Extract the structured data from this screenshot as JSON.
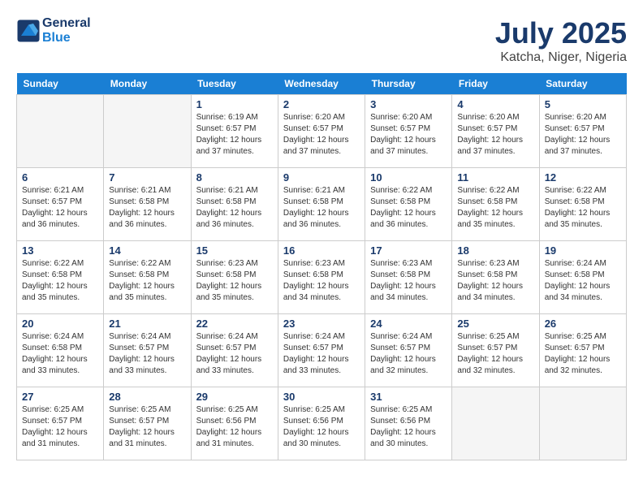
{
  "header": {
    "logo_line1": "General",
    "logo_line2": "Blue",
    "month_title": "July 2025",
    "location": "Katcha, Niger, Nigeria"
  },
  "weekdays": [
    "Sunday",
    "Monday",
    "Tuesday",
    "Wednesday",
    "Thursday",
    "Friday",
    "Saturday"
  ],
  "weeks": [
    [
      {
        "day": "",
        "empty": true
      },
      {
        "day": "",
        "empty": true
      },
      {
        "day": "1",
        "sunrise": "6:19 AM",
        "sunset": "6:57 PM",
        "daylight": "12 hours and 37 minutes."
      },
      {
        "day": "2",
        "sunrise": "6:20 AM",
        "sunset": "6:57 PM",
        "daylight": "12 hours and 37 minutes."
      },
      {
        "day": "3",
        "sunrise": "6:20 AM",
        "sunset": "6:57 PM",
        "daylight": "12 hours and 37 minutes."
      },
      {
        "day": "4",
        "sunrise": "6:20 AM",
        "sunset": "6:57 PM",
        "daylight": "12 hours and 37 minutes."
      },
      {
        "day": "5",
        "sunrise": "6:20 AM",
        "sunset": "6:57 PM",
        "daylight": "12 hours and 37 minutes."
      }
    ],
    [
      {
        "day": "6",
        "sunrise": "6:21 AM",
        "sunset": "6:57 PM",
        "daylight": "12 hours and 36 minutes."
      },
      {
        "day": "7",
        "sunrise": "6:21 AM",
        "sunset": "6:58 PM",
        "daylight": "12 hours and 36 minutes."
      },
      {
        "day": "8",
        "sunrise": "6:21 AM",
        "sunset": "6:58 PM",
        "daylight": "12 hours and 36 minutes."
      },
      {
        "day": "9",
        "sunrise": "6:21 AM",
        "sunset": "6:58 PM",
        "daylight": "12 hours and 36 minutes."
      },
      {
        "day": "10",
        "sunrise": "6:22 AM",
        "sunset": "6:58 PM",
        "daylight": "12 hours and 36 minutes."
      },
      {
        "day": "11",
        "sunrise": "6:22 AM",
        "sunset": "6:58 PM",
        "daylight": "12 hours and 35 minutes."
      },
      {
        "day": "12",
        "sunrise": "6:22 AM",
        "sunset": "6:58 PM",
        "daylight": "12 hours and 35 minutes."
      }
    ],
    [
      {
        "day": "13",
        "sunrise": "6:22 AM",
        "sunset": "6:58 PM",
        "daylight": "12 hours and 35 minutes."
      },
      {
        "day": "14",
        "sunrise": "6:22 AM",
        "sunset": "6:58 PM",
        "daylight": "12 hours and 35 minutes."
      },
      {
        "day": "15",
        "sunrise": "6:23 AM",
        "sunset": "6:58 PM",
        "daylight": "12 hours and 35 minutes."
      },
      {
        "day": "16",
        "sunrise": "6:23 AM",
        "sunset": "6:58 PM",
        "daylight": "12 hours and 34 minutes."
      },
      {
        "day": "17",
        "sunrise": "6:23 AM",
        "sunset": "6:58 PM",
        "daylight": "12 hours and 34 minutes."
      },
      {
        "day": "18",
        "sunrise": "6:23 AM",
        "sunset": "6:58 PM",
        "daylight": "12 hours and 34 minutes."
      },
      {
        "day": "19",
        "sunrise": "6:24 AM",
        "sunset": "6:58 PM",
        "daylight": "12 hours and 34 minutes."
      }
    ],
    [
      {
        "day": "20",
        "sunrise": "6:24 AM",
        "sunset": "6:58 PM",
        "daylight": "12 hours and 33 minutes."
      },
      {
        "day": "21",
        "sunrise": "6:24 AM",
        "sunset": "6:57 PM",
        "daylight": "12 hours and 33 minutes."
      },
      {
        "day": "22",
        "sunrise": "6:24 AM",
        "sunset": "6:57 PM",
        "daylight": "12 hours and 33 minutes."
      },
      {
        "day": "23",
        "sunrise": "6:24 AM",
        "sunset": "6:57 PM",
        "daylight": "12 hours and 33 minutes."
      },
      {
        "day": "24",
        "sunrise": "6:24 AM",
        "sunset": "6:57 PM",
        "daylight": "12 hours and 32 minutes."
      },
      {
        "day": "25",
        "sunrise": "6:25 AM",
        "sunset": "6:57 PM",
        "daylight": "12 hours and 32 minutes."
      },
      {
        "day": "26",
        "sunrise": "6:25 AM",
        "sunset": "6:57 PM",
        "daylight": "12 hours and 32 minutes."
      }
    ],
    [
      {
        "day": "27",
        "sunrise": "6:25 AM",
        "sunset": "6:57 PM",
        "daylight": "12 hours and 31 minutes."
      },
      {
        "day": "28",
        "sunrise": "6:25 AM",
        "sunset": "6:57 PM",
        "daylight": "12 hours and 31 minutes."
      },
      {
        "day": "29",
        "sunrise": "6:25 AM",
        "sunset": "6:56 PM",
        "daylight": "12 hours and 31 minutes."
      },
      {
        "day": "30",
        "sunrise": "6:25 AM",
        "sunset": "6:56 PM",
        "daylight": "12 hours and 30 minutes."
      },
      {
        "day": "31",
        "sunrise": "6:25 AM",
        "sunset": "6:56 PM",
        "daylight": "12 hours and 30 minutes."
      },
      {
        "day": "",
        "empty": true
      },
      {
        "day": "",
        "empty": true
      }
    ]
  ]
}
